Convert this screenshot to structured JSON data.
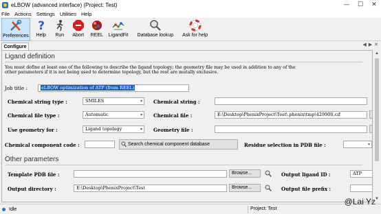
{
  "window": {
    "title": "eLBOW (advanced interface) (Project: Test)",
    "controls": [
      "—",
      "☐",
      "✕"
    ]
  },
  "menu": [
    "File",
    "Actions",
    "Settings",
    "Utilities",
    "Help"
  ],
  "toolbar": {
    "preferences": "Preferences",
    "help": "Help",
    "run": "Run",
    "abort": "Abort",
    "reel": "REEL",
    "ligandfit": "LigandFit",
    "database_lookup": "Database lookup",
    "ask_for_help": "Ask for help"
  },
  "tabs": {
    "active": "Configure",
    "arrows": [
      "◀",
      "▶",
      "✕"
    ]
  },
  "ligand_definition": {
    "heading": "Ligand definition",
    "note": "You must define at least one of the following to describe the ligand topology; the geometry file may be used in addition to any of the other parameters if it is not being used to determine topology, but the rest are mutally exclusive.",
    "job_title_label": "Job title :",
    "job_title_value": "eLBOW optimization of ATP (from REEL)",
    "chemical_string_type_label": "Chemical string type :",
    "chemical_string_type_value": "SMILES",
    "chemical_string_label": "Chemical string :",
    "chemical_string_value": "",
    "chemical_file_type_label": "Chemical file type :",
    "chemical_file_type_value": "Automatic",
    "chemical_file_label": "Chemical file :",
    "chemical_file_value": "E:\\Desktop\\PhenixProject\\Test\\.phenix\\tmp\\429900.cif",
    "use_geometry_for_label": "Use geometry for :",
    "use_geometry_for_value": "Ligand topology",
    "geometry_file_label": "Geometry file :",
    "geometry_file_value": "",
    "browse_stub": "B",
    "chemical_component_code_label": "Chemical component code :",
    "chemical_component_code_value": "",
    "search_ccd_button": "Search chemical component database",
    "residue_selection_label": "Residue selection in PDB file :",
    "residue_selection_value": ""
  },
  "other_parameters": {
    "heading": "Other parameters",
    "template_pdb_label": "Template PDB file :",
    "template_pdb_value": "",
    "browse_label": "Browse...",
    "output_ligand_id_label": "Output ligand ID :",
    "output_ligand_id_value": "ATP",
    "output_directory_label": "Output directory :",
    "output_directory_value": "E:\\Desktop\\PhenixProject\\Test",
    "output_file_prefix_label": "Output file prefix :",
    "output_file_prefix_value": ""
  },
  "status": {
    "state": "Idle",
    "project": "Project: Test"
  },
  "watermark": "@Lai Yz",
  "colors": {
    "selection": "#1b5fb3",
    "accent": "#2e6fb7",
    "toolbar_pressed": "#cce4f7"
  }
}
